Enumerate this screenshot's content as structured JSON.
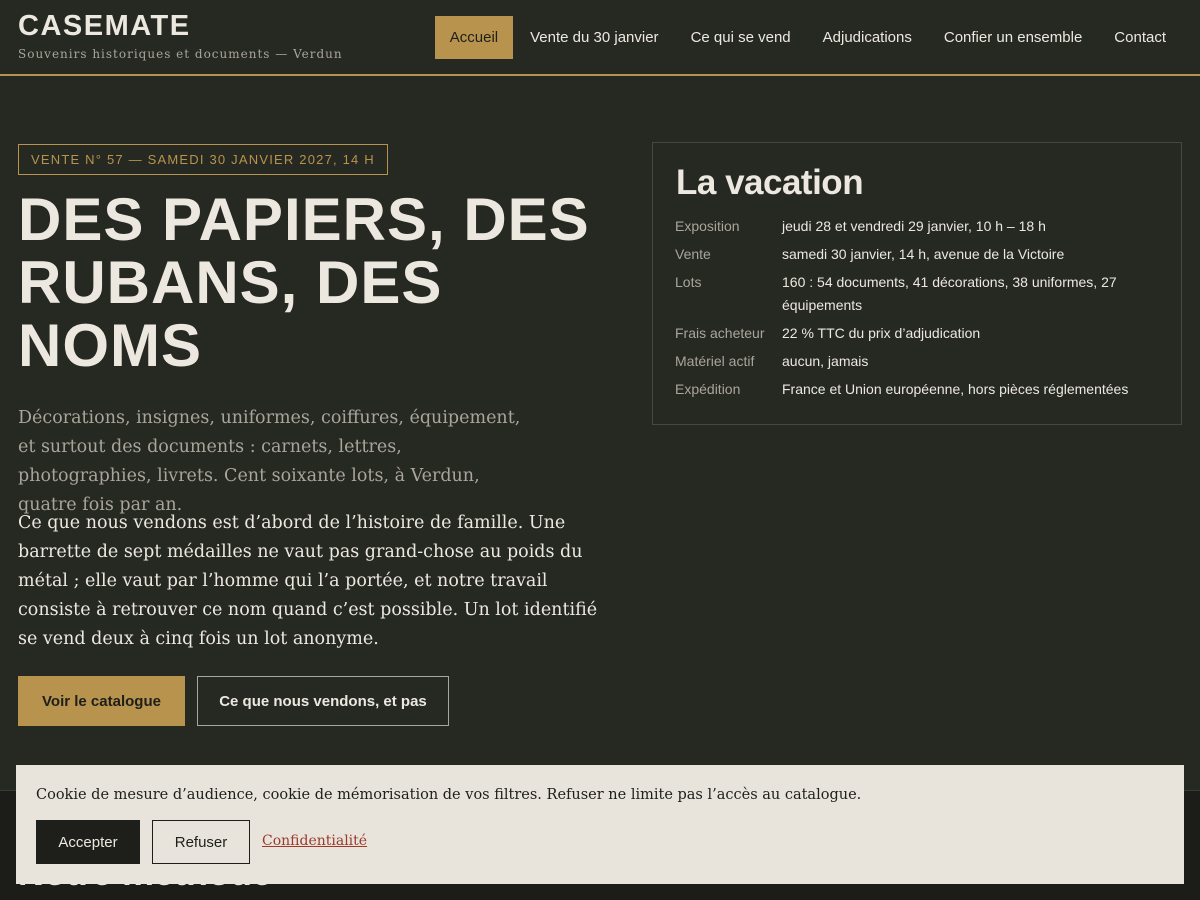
{
  "header": {
    "brand": "CASEMATE",
    "tagline": "Souvenirs historiques et documents — Verdun",
    "nav": [
      "Accueil",
      "Vente du 30 janvier",
      "Ce qui se vend",
      "Adjudications",
      "Confier un ensemble",
      "Contact"
    ],
    "active_nav": "Accueil"
  },
  "hero": {
    "badge": "VENTE N° 57 — SAMEDI 30 JANVIER 2027, 14 H",
    "title": "DES PAPIERS, DES RUBANS, DES NOMS",
    "lede": "Décorations, insignes, uniformes, coiffures, équipement, et surtout des documents : carnets, lettres, photographies, livrets. Cent soixante lots, à Verdun, quatre fois par an.",
    "body": "Ce que nous vendons est d’abord de l’histoire de famille. Une barrette de sept médailles ne vaut pas grand-chose au poids du métal ; elle vaut par l’homme qui l’a portée, et notre travail consiste à retrouver ce nom quand c’est possible. Un lot identifié se vend deux à cinq fois un lot anonyme.",
    "primary_button": "Voir le catalogue",
    "secondary_button": "Ce que nous vendons, et pas"
  },
  "card": {
    "title": "La vacation",
    "rows": [
      {
        "label": "Exposition",
        "value": "jeudi 28 et vendredi 29 janvier, 10 h – 18 h"
      },
      {
        "label": "Vente",
        "value": "samedi 30 janvier, 14 h, avenue de la Victoire"
      },
      {
        "label": "Lots",
        "value": "160 : 54 documents, 41 décorations, 38 uniformes, 27 équipements"
      },
      {
        "label": "Frais acheteur",
        "value": "22 % TTC du prix d’adjudication"
      },
      {
        "label": "Matériel actif",
        "value": "aucun, jamais"
      },
      {
        "label": "Expédition",
        "value": "France et Union européenne, hors pièces réglementées"
      }
    ]
  },
  "lower": {
    "title": "Notre méthode"
  },
  "cookie": {
    "text": "Cookie de mesure d’audience, cookie de mémorisation de vos filtres. Refuser ne limite pas l’accès au catalogue.",
    "accept": "Accepter",
    "refuse": "Refuser",
    "link": "Confidentialité"
  },
  "colors": {
    "background": "#262822",
    "accent": "#b8934e",
    "text": "#ece8e0",
    "muted": "#a9a59b",
    "banner": "#e8e4dc"
  }
}
